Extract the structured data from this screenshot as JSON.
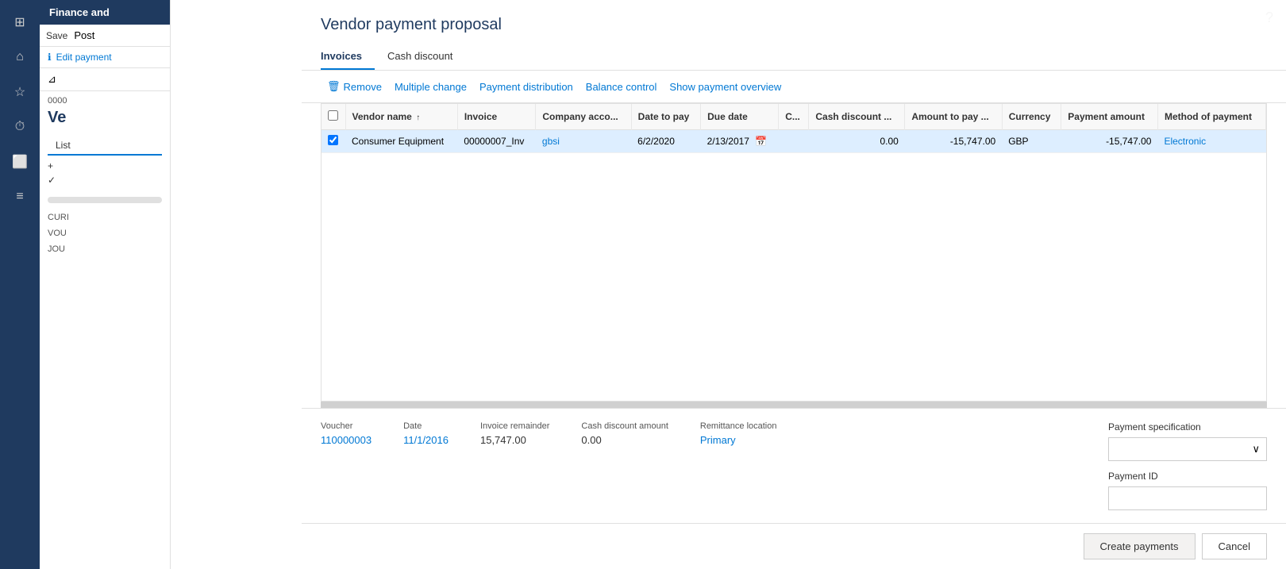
{
  "app": {
    "title": "Finance and",
    "help_icon": "?"
  },
  "sidebar": {
    "icons": [
      "grid",
      "home",
      "star",
      "clock",
      "chart",
      "list"
    ]
  },
  "left_panel": {
    "header": "Finance and",
    "save_label": "Save",
    "post_label": "Post",
    "edit_payment_label": "Edit payment",
    "filter_label": "Filter",
    "record_id": "0000",
    "vendor_abbr": "Ve",
    "list_tab": "List",
    "actions": [
      "+",
      "✓"
    ],
    "curi_label": "CURI",
    "vou_label": "VOU",
    "jou_label": "JOU"
  },
  "dialog": {
    "title": "Vendor payment proposal",
    "tabs": [
      {
        "label": "Invoices",
        "active": true
      },
      {
        "label": "Cash discount",
        "active": false
      }
    ],
    "toolbar": [
      {
        "label": "Remove",
        "icon": "remove"
      },
      {
        "label": "Multiple change",
        "icon": "change"
      },
      {
        "label": "Payment distribution",
        "icon": "dist"
      },
      {
        "label": "Balance control",
        "icon": "balance"
      },
      {
        "label": "Show payment overview",
        "icon": "overview"
      }
    ],
    "grid": {
      "columns": [
        {
          "key": "checkbox",
          "label": ""
        },
        {
          "key": "vendor_name",
          "label": "Vendor name",
          "sortable": true
        },
        {
          "key": "invoice",
          "label": "Invoice"
        },
        {
          "key": "company_acco",
          "label": "Company acco..."
        },
        {
          "key": "date_to_pay",
          "label": "Date to pay"
        },
        {
          "key": "due_date",
          "label": "Due date"
        },
        {
          "key": "c",
          "label": "C..."
        },
        {
          "key": "cash_discount",
          "label": "Cash discount ..."
        },
        {
          "key": "amount_to_pay",
          "label": "Amount to pay ..."
        },
        {
          "key": "currency",
          "label": "Currency"
        },
        {
          "key": "payment_amount",
          "label": "Payment amount"
        },
        {
          "key": "method_of_payment",
          "label": "Method of payment"
        }
      ],
      "rows": [
        {
          "selected": true,
          "vendor_name": "Consumer Equipment",
          "invoice": "00000007_Inv",
          "company_acco": "gbsi",
          "date_to_pay": "6/2/2020",
          "due_date": "2/13/2017",
          "c": "",
          "cash_discount": "0.00",
          "amount_to_pay": "-15,747.00",
          "currency": "GBP",
          "payment_amount": "-15,747.00",
          "method_of_payment": "Electronic"
        }
      ]
    },
    "bottom": {
      "voucher_label": "Voucher",
      "voucher_value": "110000003",
      "date_label": "Date",
      "date_value": "11/1/2016",
      "invoice_remainder_label": "Invoice remainder",
      "invoice_remainder_value": "15,747.00",
      "cash_discount_amount_label": "Cash discount amount",
      "cash_discount_amount_value": "0.00",
      "remittance_location_label": "Remittance location",
      "remittance_location_value": "Primary",
      "payment_spec_label": "Payment specification",
      "payment_spec_value": "",
      "payment_id_label": "Payment ID",
      "payment_id_value": ""
    },
    "footer": {
      "create_payments_label": "Create payments",
      "cancel_label": "Cancel"
    }
  }
}
